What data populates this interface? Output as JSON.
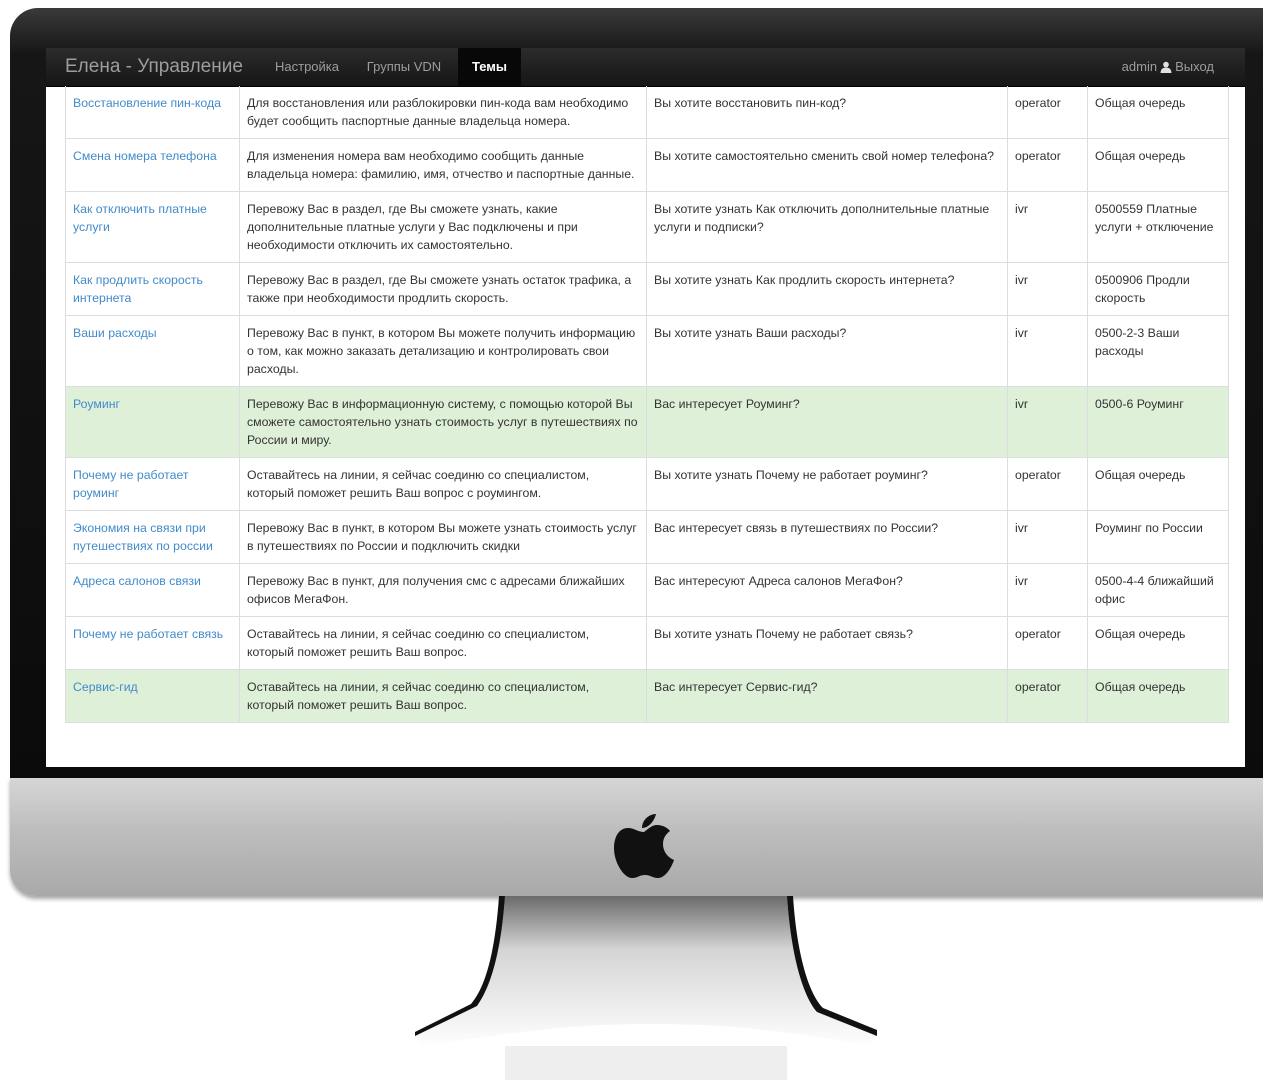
{
  "navbar": {
    "brand": "Елена - Управление",
    "links": [
      {
        "label": "Настройка",
        "active": false
      },
      {
        "label": "Группы VDN",
        "active": false
      },
      {
        "label": "Темы",
        "active": true
      }
    ],
    "user": "admin",
    "logout": "Выход"
  },
  "topics": {
    "rows": [
      {
        "topic": "Восстановление пин-кода",
        "text": "Для восстановления или разблокировки пин-кода вам необходимо будет сообщить паспортные данные владельца номера.",
        "question": "Вы хотите восстановить пин-код?",
        "route": "operator",
        "target": "Общая очередь",
        "highlight": false
      },
      {
        "topic": "Смена номера телефона",
        "text": "Для изменения номера вам необходимо сообщить данные владельца номера: фамилию, имя, отчество и паспортные данные.",
        "question": "Вы хотите самостоятельно сменить свой номер телефона?",
        "route": "operator",
        "target": "Общая очередь",
        "highlight": false
      },
      {
        "topic": "Как отключить платные услуги",
        "text": "Перевожу Вас в раздел, где Вы сможете узнать, какие дополнительные платные услуги у Вас подключены и при необходимости отключить их самостоятельно.",
        "question": "Вы хотите узнать Как отключить дополнительные платные услуги и подписки?",
        "route": "ivr",
        "target": "0500559 Платные услуги + отключение",
        "highlight": false
      },
      {
        "topic": "Как продлить скорость интернета",
        "text": "Перевожу Вас в раздел, где Вы сможете узнать остаток трафика, а также при необходимости продлить скорость.",
        "question": "Вы хотите узнать Как продлить скорость интернета?",
        "route": "ivr",
        "target": "0500906 Продли скорость",
        "highlight": false
      },
      {
        "topic": "Ваши расходы",
        "text": "Перевожу Вас в пункт, в котором Вы можете получить информацию о том, как можно заказать детализацию и контролировать свои расходы.",
        "question": "Вы хотите узнать Ваши расходы?",
        "route": "ivr",
        "target": "0500-2-3 Ваши расходы",
        "highlight": false
      },
      {
        "topic": "Роуминг",
        "text": "Перевожу Вас в информационную систему, с помощью которой Вы сможете самостоятельно узнать стоимость услуг в путешествиях по России и миру.",
        "question": "Вас интересует Роуминг?",
        "route": "ivr",
        "target": "0500-6 Роуминг",
        "highlight": true
      },
      {
        "topic": "Почему не работает роуминг",
        "text": "Оставайтесь на линии, я сейчас соединю со специалистом, который поможет решить Ваш вопрос с роумингом.",
        "question": "Вы хотите узнать Почему не работает роуминг?",
        "route": "operator",
        "target": "Общая очередь",
        "highlight": false
      },
      {
        "topic": "Экономия на связи при путешествиях по россии",
        "text": "Перевожу Вас в пункт, в котором Вы можете узнать стоимость услуг в путешествиях по России и подключить скидки",
        "question": "Вас интересует связь в путешествиях по России?",
        "route": "ivr",
        "target": "Роуминг по России",
        "highlight": false
      },
      {
        "topic": "Адреса салонов связи",
        "text": "Перевожу Вас в пункт, для получения смс с адресами ближайших офисов МегаФон.",
        "question": "Вас интересуют Адреса салонов МегаФон?",
        "route": "ivr",
        "target": "0500-4-4 ближайший офис",
        "highlight": false
      },
      {
        "topic": "Почему не работает связь",
        "text": "Оставайтесь на линии, я сейчас соединю со специалистом, который поможет решить Ваш вопрос.",
        "question": "Вы хотите узнать Почему не работает связь?",
        "route": "operator",
        "target": "Общая очередь",
        "highlight": false
      },
      {
        "topic": "Сервис-гид",
        "text": "Оставайтесь на линии, я сейчас соединю со специалистом, который поможет решить Ваш вопрос.",
        "question": "Вас интересует Сервис-гид?",
        "route": "operator",
        "target": "Общая очередь",
        "highlight": true
      }
    ]
  }
}
